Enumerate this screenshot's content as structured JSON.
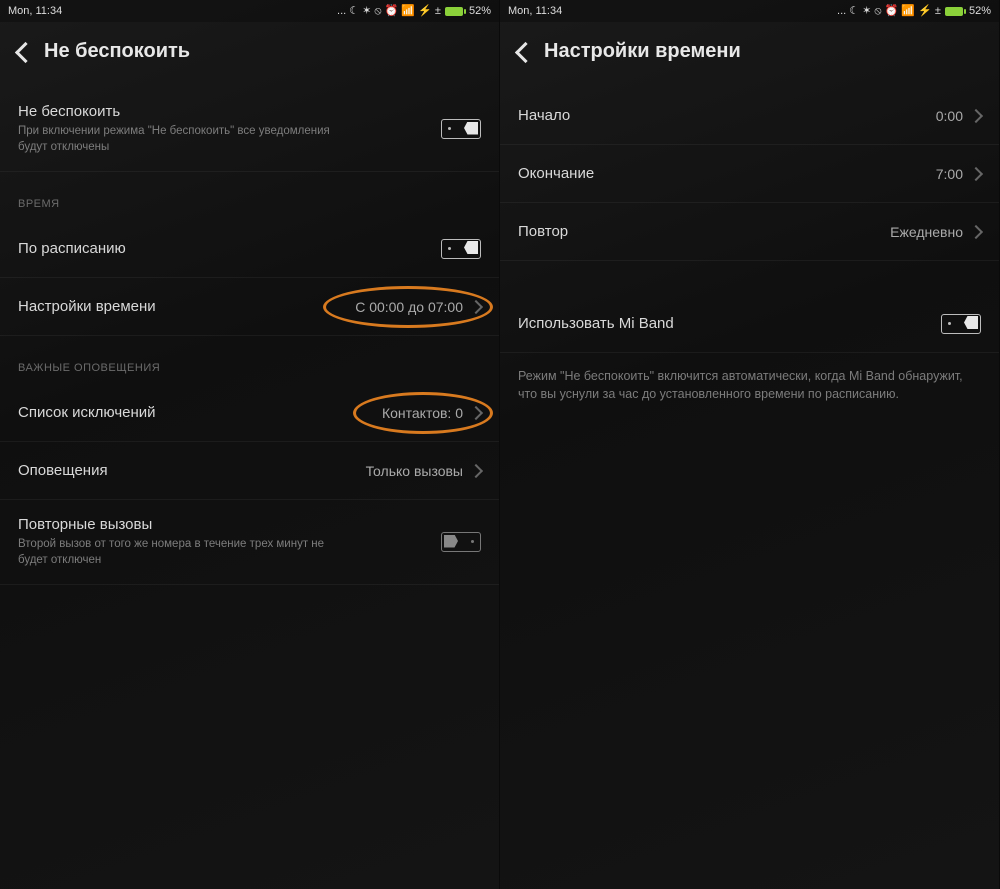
{
  "status": {
    "time": "Mon, 11:34",
    "icons": "...  ☾  ✶  ⦸  ⏰  📶  ⚡ ±",
    "battery": "52%"
  },
  "left": {
    "headerTitle": "Не беспокоить",
    "dnd": {
      "label": "Не беспокоить",
      "sub": "При включении режима \"Не беспокоить\" все уведомления будут отключены"
    },
    "sectionTime": "ВРЕМЯ",
    "schedule": {
      "label": "По расписанию"
    },
    "timeSettings": {
      "label": "Настройки времени",
      "value": "С 00:00 до 07:00"
    },
    "sectionAlerts": "ВАЖНЫЕ ОПОВЕЩЕНИЯ",
    "exceptions": {
      "label": "Список исключений",
      "value": "Контактов: 0"
    },
    "alerts": {
      "label": "Оповещения",
      "value": "Только вызовы"
    },
    "repeat": {
      "label": "Повторные вызовы",
      "sub": "Второй вызов от того же номера в течение трех минут не будет отключен"
    }
  },
  "right": {
    "headerTitle": "Настройки времени",
    "start": {
      "label": "Начало",
      "value": "0:00"
    },
    "end": {
      "label": "Окончание",
      "value": "7:00"
    },
    "repeat": {
      "label": "Повтор",
      "value": "Ежедневно"
    },
    "miband": {
      "label": "Использовать Mi Band"
    },
    "desc": "Режим \"Не беспокоить\" включится автоматически, когда Mi Band обнаружит, что вы уснули за час до установленного времени по расписанию."
  }
}
